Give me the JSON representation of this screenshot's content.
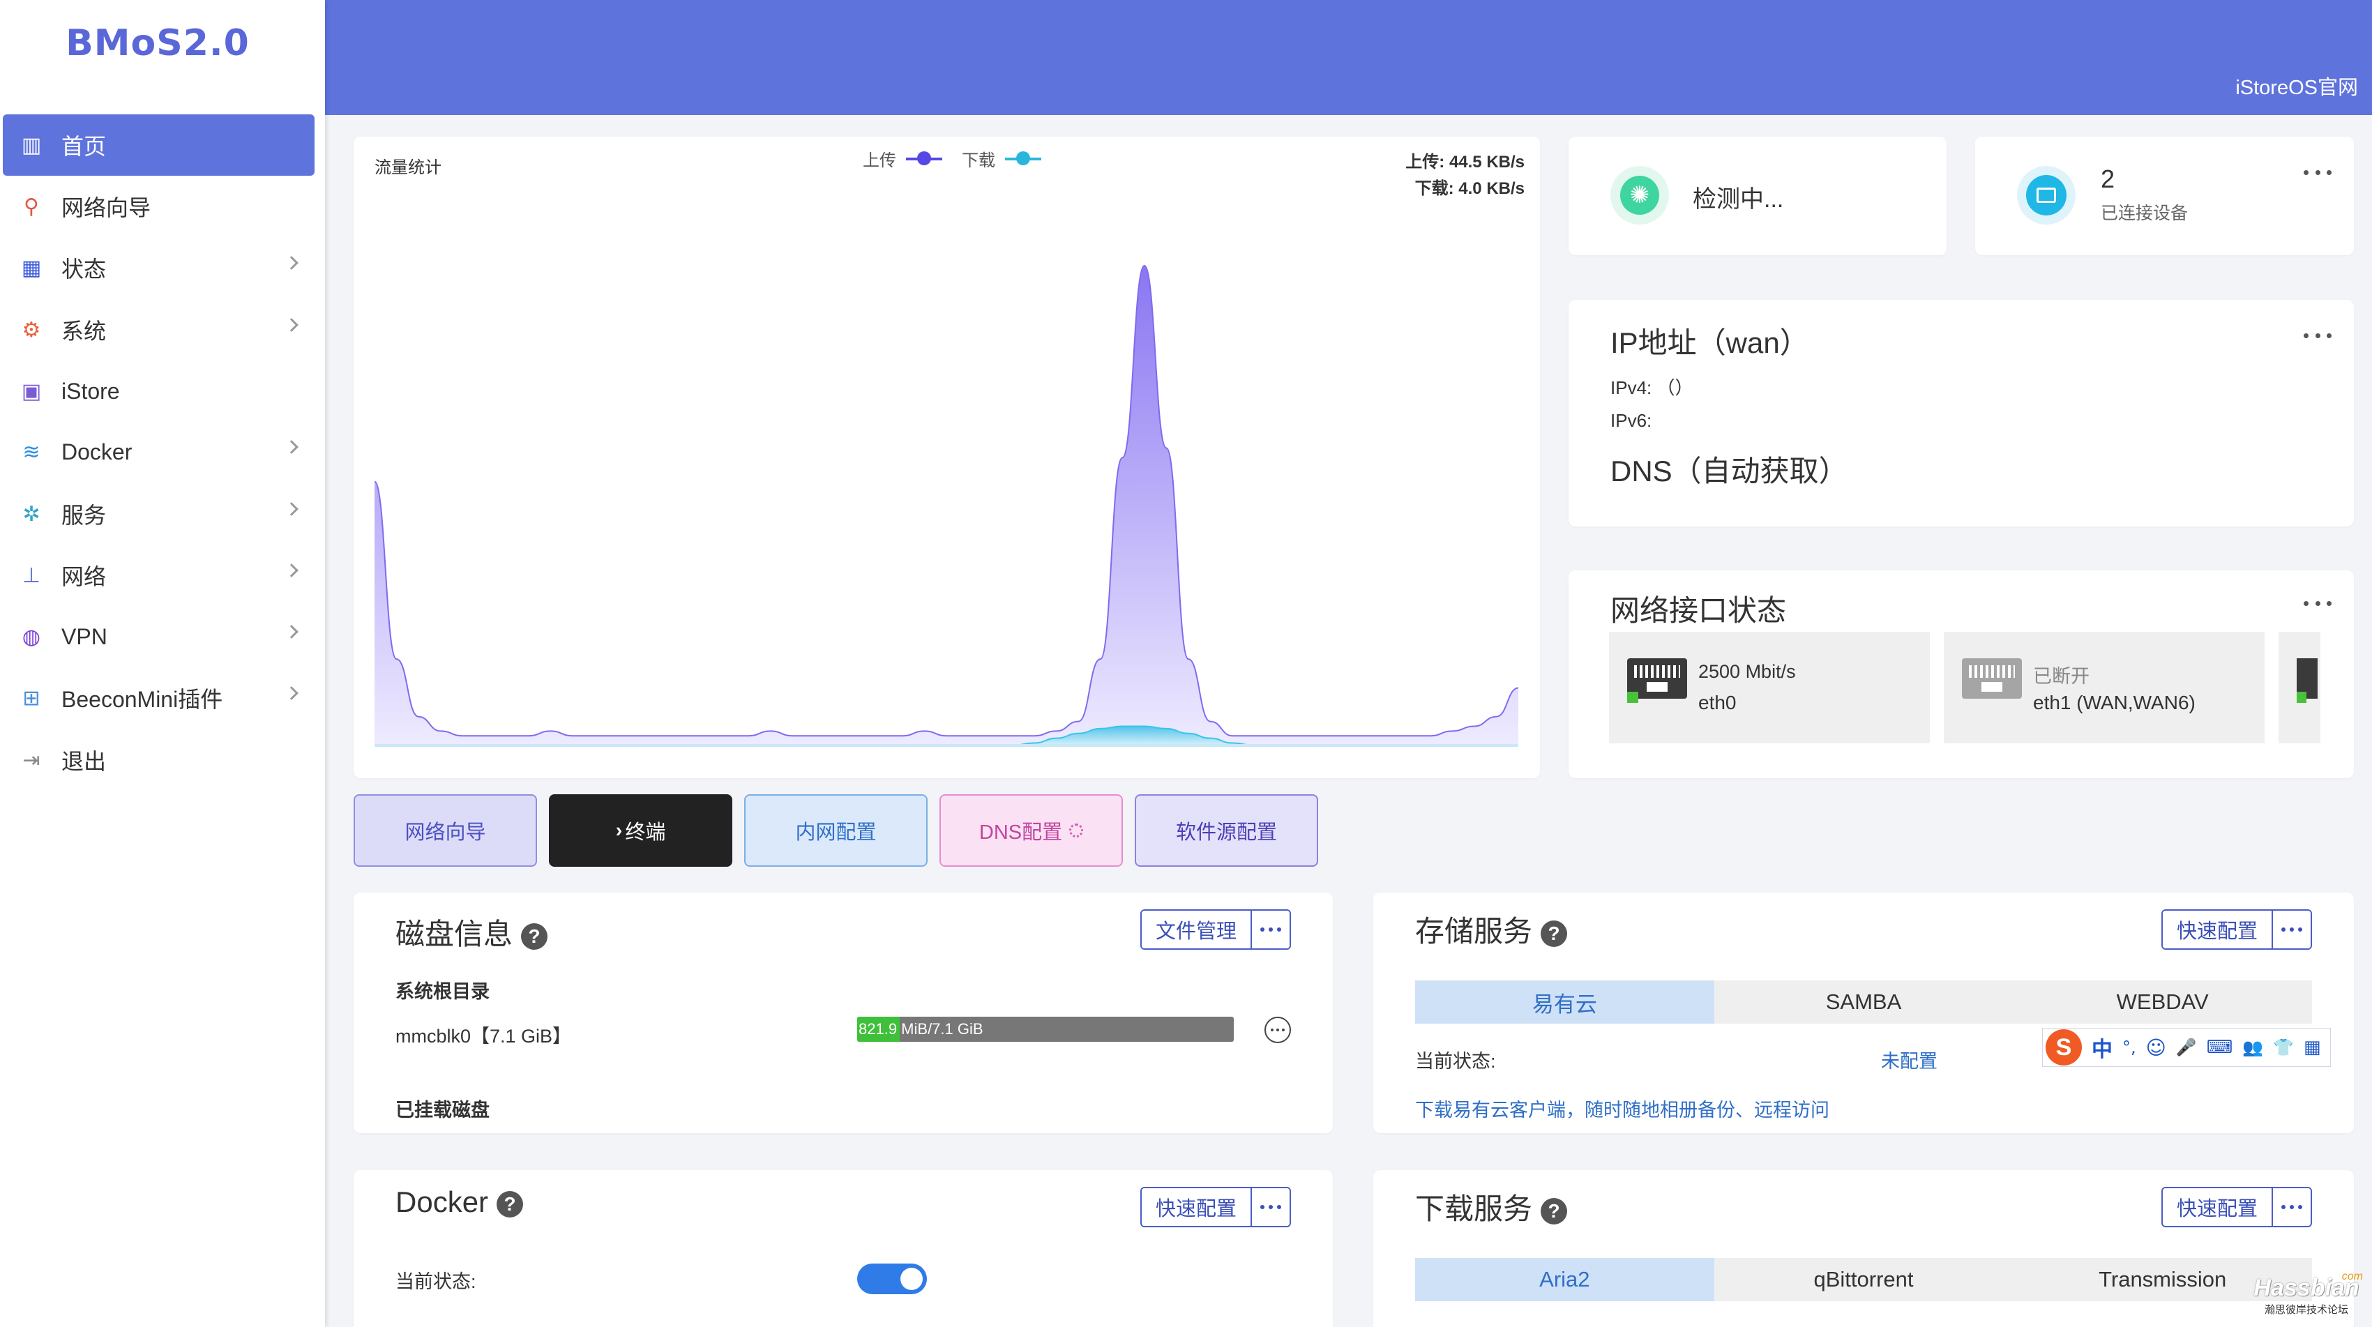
{
  "app": {
    "logo": "BMoS2.0",
    "header_link": "iStoreOS官网"
  },
  "sidebar": {
    "items": [
      {
        "label": "首页",
        "icon": "home-dashboard-icon",
        "active": true,
        "has_children": false
      },
      {
        "label": "网络向导",
        "icon": "wizard-pin-icon",
        "has_children": false
      },
      {
        "label": "状态",
        "icon": "grid-status-icon",
        "has_children": true
      },
      {
        "label": "系统",
        "icon": "gear-icon",
        "has_children": true
      },
      {
        "label": "iStore",
        "icon": "store-bag-icon",
        "has_children": false
      },
      {
        "label": "Docker",
        "icon": "docker-whale-icon",
        "has_children": true
      },
      {
        "label": "服务",
        "icon": "services-gears-icon",
        "has_children": true
      },
      {
        "label": "网络",
        "icon": "network-tree-icon",
        "has_children": true
      },
      {
        "label": "VPN",
        "icon": "vpn-globe-icon",
        "has_children": true
      },
      {
        "label": "BeeconMini插件",
        "icon": "plugin-blocks-icon",
        "has_children": true
      },
      {
        "label": "退出",
        "icon": "logout-icon",
        "has_children": false
      }
    ]
  },
  "traffic": {
    "title": "流量统计",
    "legend_upload": "上传",
    "legend_download": "下载",
    "upload_rate": "上传: 44.5 KB/s",
    "download_rate": "下载: 4.0 KB/s",
    "upload_color": "#7c6cf0",
    "download_color": "#36c6e8",
    "series_upload": [
      0.55,
      0.18,
      0.06,
      0.03,
      0.02,
      0.02,
      0.02,
      0.02,
      0.03,
      0.02,
      0.02,
      0.02,
      0.02,
      0.02,
      0.02,
      0.02,
      0.02,
      0.02,
      0.03,
      0.02,
      0.02,
      0.02,
      0.02,
      0.02,
      0.02,
      0.03,
      0.02,
      0.02,
      0.02,
      0.02,
      0.02,
      0.03,
      0.05,
      0.18,
      0.6,
      1.0,
      0.62,
      0.18,
      0.05,
      0.02,
      0.02,
      0.02,
      0.02,
      0.02,
      0.02,
      0.02,
      0.02,
      0.02,
      0.02,
      0.03,
      0.04,
      0.06,
      0.12
    ],
    "series_download": [
      0.0,
      0.0,
      0.0,
      0.0,
      0.0,
      0.0,
      0.0,
      0.0,
      0.0,
      0.0,
      0.0,
      0.0,
      0.0,
      0.0,
      0.0,
      0.0,
      0.0,
      0.0,
      0.0,
      0.0,
      0.0,
      0.0,
      0.0,
      0.0,
      0.0,
      0.0,
      0.0,
      0.0,
      0.0,
      0.0,
      0.005,
      0.015,
      0.025,
      0.035,
      0.04,
      0.04,
      0.035,
      0.025,
      0.015,
      0.005,
      0.0,
      0.0,
      0.0,
      0.0,
      0.0,
      0.0,
      0.0,
      0.0,
      0.0,
      0.0,
      0.0,
      0.0,
      0.0
    ]
  },
  "status_cards": {
    "check_text": "检测中...",
    "devices_count": "2",
    "devices_label": "已连接设备"
  },
  "ip_card": {
    "title": "IP地址（wan）",
    "ipv4": "IPv4: （）",
    "ipv6": "IPv6:",
    "dns": "DNS（自动获取）"
  },
  "iface_card": {
    "title": "网络接口状态",
    "ports": [
      {
        "speed": "2500 Mbit/s",
        "name": "eth0",
        "connected": true
      },
      {
        "speed": "已断开",
        "name": "eth1 (WAN,WAN6)",
        "connected": false
      }
    ]
  },
  "quick_buttons": [
    {
      "label": "网络向导",
      "bg": "#dcdcf8",
      "border": "#8f8fe0",
      "color": "#4b4fc2"
    },
    {
      "label": "终端",
      "prefix": "›",
      "bg": "#222222",
      "border": "#222222",
      "color": "#ffffff"
    },
    {
      "label": "内网配置",
      "bg": "#dbe9fb",
      "border": "#7eaee6",
      "color": "#2f6fc7"
    },
    {
      "label": "DNS配置",
      "bg": "#fbe1f4",
      "border": "#e68cd1",
      "color": "#c2459f"
    },
    {
      "label": "软件源配置",
      "bg": "#e4e1fb",
      "border": "#8b82dd",
      "color": "#4b40b5"
    }
  ],
  "disk": {
    "title": "磁盘信息",
    "help": "?",
    "btn_file": "文件管理",
    "section_root": "系统根目录",
    "root_disk": "mmcblk0【7.1 GiB】",
    "usage_used": "821.9",
    "usage_rest": " MiB/7.1 GiB",
    "usage_percent": 11.3,
    "section_mounted": "已挂载磁盘"
  },
  "storage": {
    "title": "存储服务",
    "help": "?",
    "btn_quick": "快速配置",
    "tabs": [
      "易有云",
      "SAMBA",
      "WEBDAV"
    ],
    "selected_tab": 0,
    "status_label": "当前状态:",
    "status_value": "未配置",
    "link_text": "下载易有云客户端，随时随地相册备份、远程访问"
  },
  "docker": {
    "title": "Docker",
    "help": "?",
    "btn_quick": "快速配置",
    "status_label": "当前状态:",
    "enabled": true
  },
  "download": {
    "title": "下载服务",
    "help": "?",
    "btn_quick": "快速配置",
    "tabs": [
      "Aria2",
      "qBittorrent",
      "Transmission"
    ],
    "selected_tab": 0
  },
  "ime_toolbar": {
    "logo": "S",
    "items": [
      "中",
      "°,",
      "☺",
      "🎤",
      "⌨",
      "👥",
      "👕",
      "▦"
    ]
  },
  "watermark": {
    "main": "Hassbian",
    "sub": "瀚思彼岸技术论坛",
    "tag": "com"
  }
}
